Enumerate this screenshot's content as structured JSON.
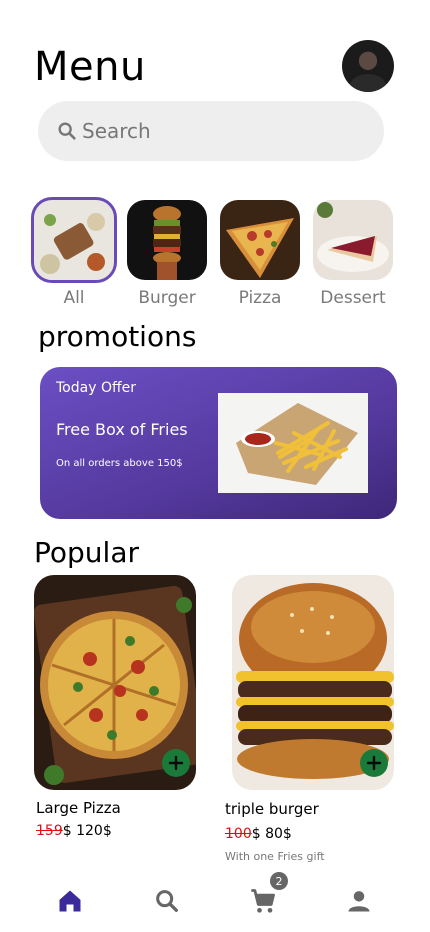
{
  "header": {
    "title": "Menu"
  },
  "search": {
    "placeholder": "Search"
  },
  "categories": [
    {
      "label": "All",
      "selected": true
    },
    {
      "label": "Burger",
      "selected": false
    },
    {
      "label": "Pizza",
      "selected": false
    },
    {
      "label": "Dessert",
      "selected": false
    }
  ],
  "promotions": {
    "heading": "promotions",
    "tag": "Today Offer",
    "title": "Free Box of Fries",
    "subtitle": "On all orders above 150$"
  },
  "popular": {
    "heading": "Popular",
    "items": [
      {
        "name": "Large Pizza",
        "old_price": "159",
        "new_price": "$ 120$",
        "note": ""
      },
      {
        "name": "triple burger",
        "old_price": "100",
        "new_price": "$ 80$",
        "note": "With one Fries gift"
      }
    ]
  },
  "nav": {
    "cart_count": "2",
    "active": "home"
  },
  "colors": {
    "accent": "#5b3fb0",
    "add_button": "#1a7a3a",
    "old_price": "#dd1111"
  }
}
